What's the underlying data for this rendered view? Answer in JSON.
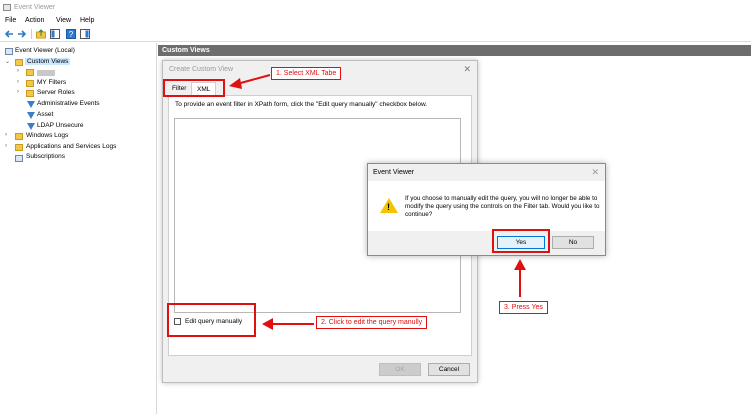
{
  "window": {
    "title": "Event Viewer"
  },
  "menu": [
    "File",
    "Action",
    "View",
    "Help"
  ],
  "tree": {
    "root": "Event Viewer (Local)",
    "custom_views": "Custom Views",
    "items": [
      "MY Filters",
      "Server Roles",
      "Administrative Events",
      "Asset",
      "LDAP Unsecure"
    ],
    "windows_logs": "Windows Logs",
    "app_logs": "Applications and Services Logs",
    "subscriptions": "Subscriptions"
  },
  "right_header": "Custom Views",
  "create_dialog": {
    "title": "Create Custom View",
    "tabs": [
      "Filter",
      "XML"
    ],
    "instruction": "To provide an event filter in XPath form, click the \"Edit query manually\" checkbox below.",
    "checkbox_label": "Edit query manually",
    "ok": "OK",
    "cancel": "Cancel"
  },
  "message_box": {
    "title": "Event Viewer",
    "text": "If you choose to manually edit the query, you will no longer be able to modify the query using the controls on the Filter tab. Would you like to continue?",
    "yes": "Yes",
    "no": "No"
  },
  "annotations": {
    "step1": "1. Select XML Tabe",
    "step2": "2. Click to edit the query manully",
    "step3": "3. Press Yes"
  },
  "colors": {
    "annotation": "#e01010",
    "warning": "#f5c400",
    "selection": "#cce8ff"
  }
}
